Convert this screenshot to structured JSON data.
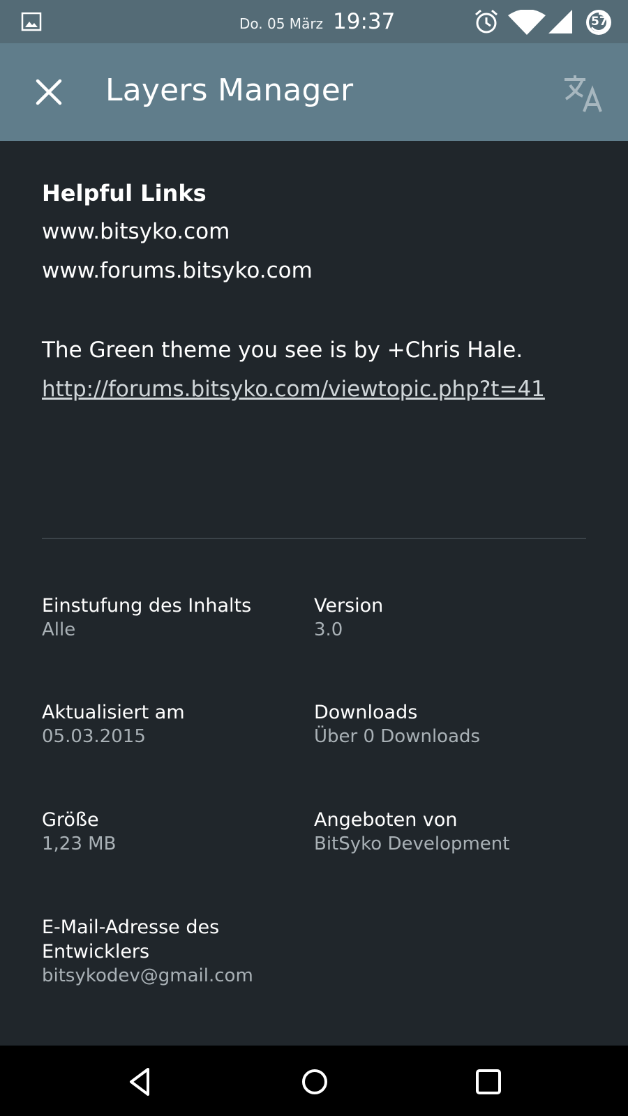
{
  "status_bar": {
    "date": "Do. 05 März",
    "time": "19:37",
    "battery": "57",
    "icons": [
      "image-icon",
      "alarm-icon",
      "wifi-icon",
      "signal-icon",
      "battery-icon"
    ]
  },
  "app_bar": {
    "title": "Layers Manager",
    "close_icon": "close-icon",
    "translate_icon": "translate-icon",
    "background": "#607d8b"
  },
  "content": {
    "heading": "Helpful Links",
    "links": [
      "www.bitsyko.com",
      "www.forums.bitsyko.com"
    ],
    "theme_note": "The Green theme you see is by +Chris Hale.",
    "theme_link": "http://forums.bitsyko.com/viewtopic.php?t=41"
  },
  "info": {
    "rating_label": "Einstufung des Inhalts",
    "rating_value": "Alle",
    "version_label": "Version",
    "version_value": "3.0",
    "updated_label": "Aktualisiert am",
    "updated_value": "05.03.2015",
    "downloads_label": "Downloads",
    "downloads_value": "Über 0 Downloads",
    "size_label": "Größe",
    "size_value": "1,23 MB",
    "offered_label": "Angeboten von",
    "offered_value": "BitSyko Development",
    "email_label_line1": "E-Mail-Adresse des",
    "email_label_line2": "Entwicklers",
    "email_value": "bitsykodev@gmail.com"
  },
  "nav_bar": {
    "icons": [
      "back-icon",
      "home-icon",
      "recents-icon"
    ]
  }
}
